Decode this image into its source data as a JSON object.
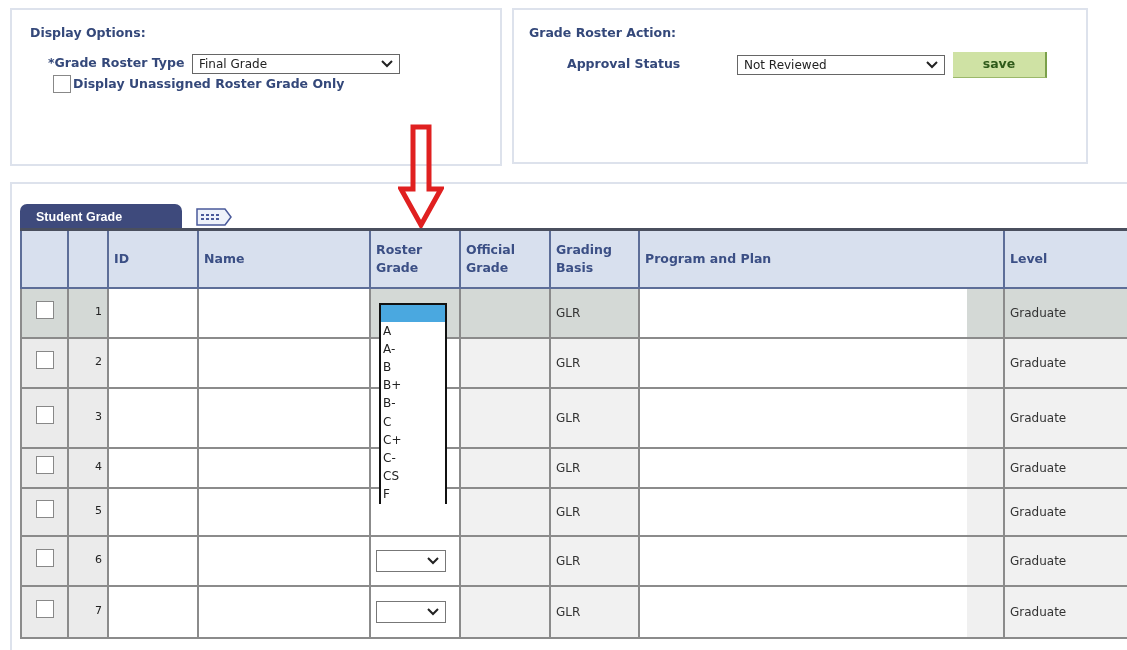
{
  "display_options": {
    "heading": "Display Options:",
    "roster_type": {
      "label": "*Grade Roster Type",
      "value": "Final Grade"
    },
    "unassigned_only": {
      "label": "Display Unassigned Roster Grade Only",
      "checked": false
    }
  },
  "roster_action": {
    "heading": "Grade Roster Action:",
    "approval_status": {
      "label": "Approval Status",
      "value": "Not Reviewed"
    },
    "save_button": "save"
  },
  "grid": {
    "tab": "Student Grade",
    "columns": [
      "ID",
      "Name",
      "Roster Grade",
      "Official Grade",
      "Grading Basis",
      "Program and Plan",
      "Level"
    ],
    "grade_list": {
      "blank_highlighted": true,
      "options": [
        "A",
        "A-",
        "B",
        "B+",
        "B-",
        "C",
        "C+",
        "C-",
        "CS",
        "F"
      ]
    },
    "rows": [
      {
        "number": "1",
        "checked": false,
        "highlighted": true,
        "grade_select": false,
        "grading_basis": "GLR",
        "level": "Graduate"
      },
      {
        "number": "2",
        "checked": false,
        "highlighted": false,
        "grade_select": false,
        "grading_basis": "GLR",
        "level": "Graduate"
      },
      {
        "number": "3",
        "checked": false,
        "highlighted": false,
        "grade_select": false,
        "grading_basis": "GLR",
        "level": "Graduate"
      },
      {
        "number": "4",
        "checked": false,
        "highlighted": false,
        "grade_select": false,
        "grading_basis": "GLR",
        "level": "Graduate"
      },
      {
        "number": "5",
        "checked": false,
        "highlighted": false,
        "grade_select": false,
        "grading_basis": "GLR",
        "level": "Graduate"
      },
      {
        "number": "6",
        "checked": false,
        "highlighted": false,
        "grade_select": true,
        "grading_basis": "GLR",
        "level": "Graduate"
      },
      {
        "number": "7",
        "checked": false,
        "highlighted": false,
        "grade_select": true,
        "grading_basis": "GLR",
        "level": "Graduate"
      }
    ]
  }
}
